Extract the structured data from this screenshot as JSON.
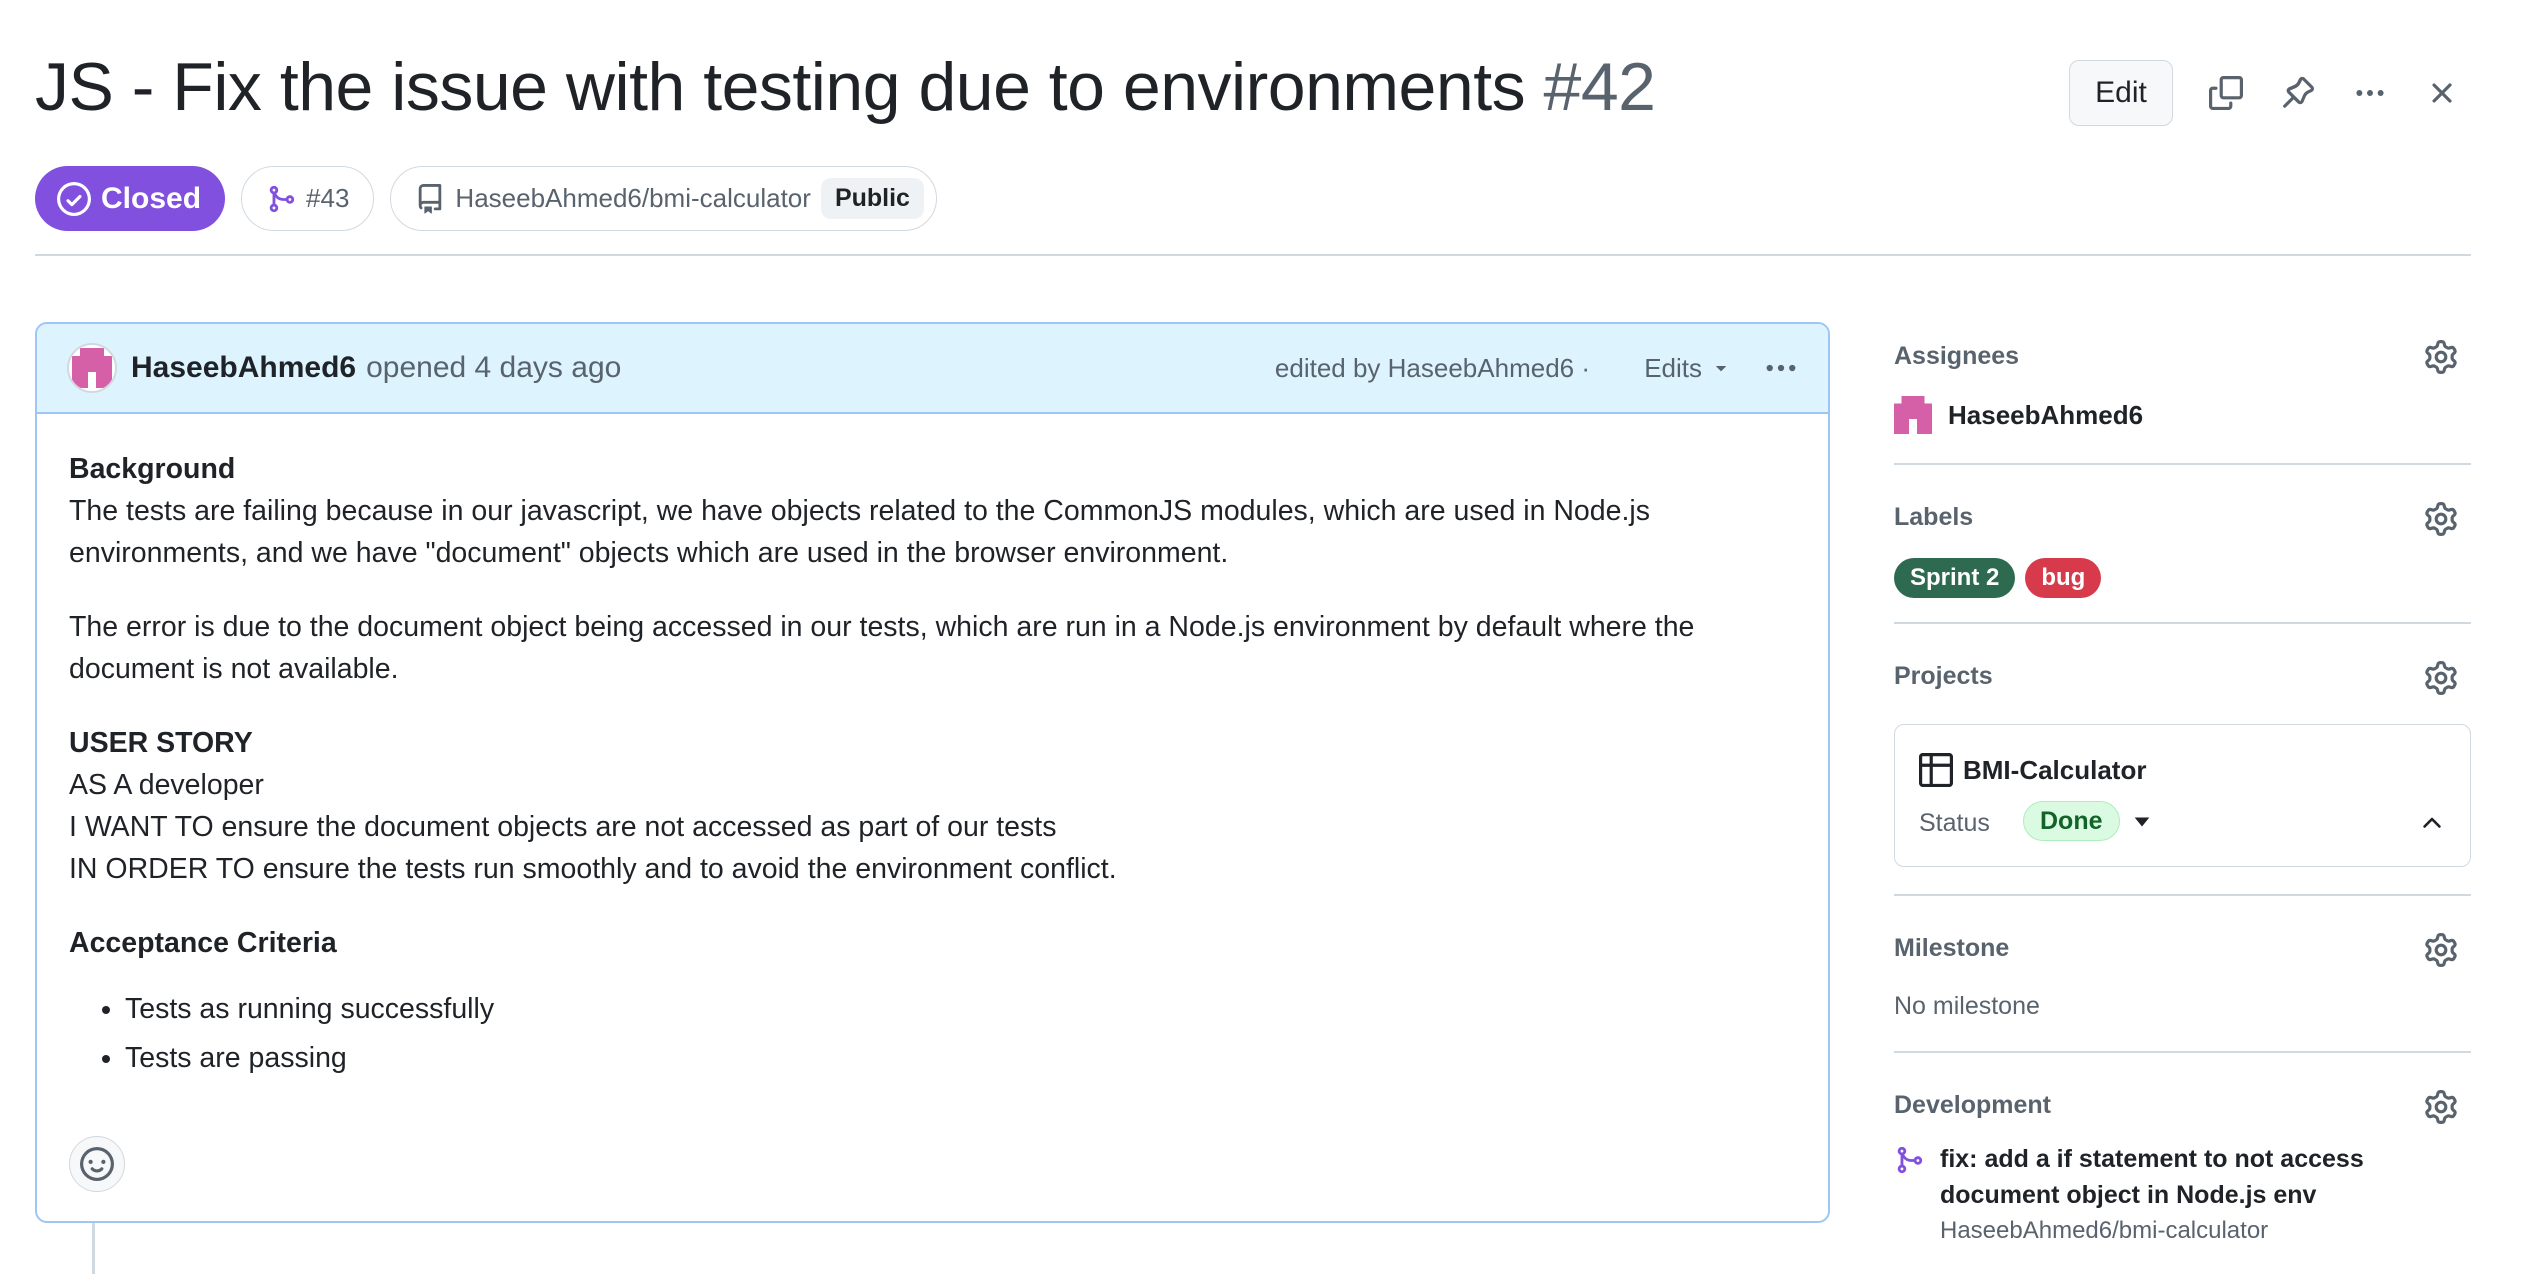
{
  "issue": {
    "title": "JS - Fix the issue with testing due to environments",
    "number": "#42",
    "state": "Closed",
    "linked_pr": "#43",
    "repo": "HaseebAhmed6/bmi-calculator",
    "visibility": "Public"
  },
  "header_actions": {
    "edit_label": "Edit",
    "icons": [
      "copy-icon",
      "pin-icon",
      "kebab-horizontal-icon",
      "close-icon"
    ]
  },
  "comment": {
    "author": "HaseebAhmed6",
    "opened_text": "opened 4 days ago",
    "edited_text": "edited by HaseebAhmed6 ·",
    "edits_label": "Edits",
    "background_heading": "Background",
    "background_text": "The tests are failing because in our javascript, we have objects related to the CommonJS modules, which are used in Node.js environments, and we have \"document\" objects which are used in the browser environment.",
    "error_text": "The error is due to the document object being accessed in our tests, which are run in a Node.js environment by default where the document is not available.",
    "story_heading": "USER STORY",
    "story_as": "AS A developer",
    "story_want": "I WANT TO ensure the document objects are not accessed as part of our tests",
    "story_order": "IN ORDER TO ensure the tests run smoothly and to avoid the environment conflict.",
    "criteria_heading": "Acceptance Criteria",
    "criteria": [
      "Tests as running successfully",
      "Tests are passing"
    ]
  },
  "sidebar": {
    "assignees": {
      "label": "Assignees",
      "user": "HaseebAhmed6"
    },
    "labels": {
      "label": "Labels",
      "items": [
        {
          "name": "Sprint 2",
          "color": "#2d6a4f"
        },
        {
          "name": "bug",
          "color": "#d73a4a"
        }
      ]
    },
    "projects": {
      "label": "Projects",
      "project_name": "BMI-Calculator",
      "status_label": "Status",
      "status_value": "Done"
    },
    "milestone": {
      "label": "Milestone",
      "value": "No milestone"
    },
    "development": {
      "label": "Development",
      "branch_title": "fix: add a if statement to not access document object in Node.js env",
      "branch_repo": "HaseebAhmed6/bmi-calculator"
    }
  },
  "colors": {
    "closed": "#8250df",
    "comment_header_bg": "#ddf4ff",
    "comment_border": "#9ec5f4",
    "avatar_pink": "#d660a8"
  }
}
